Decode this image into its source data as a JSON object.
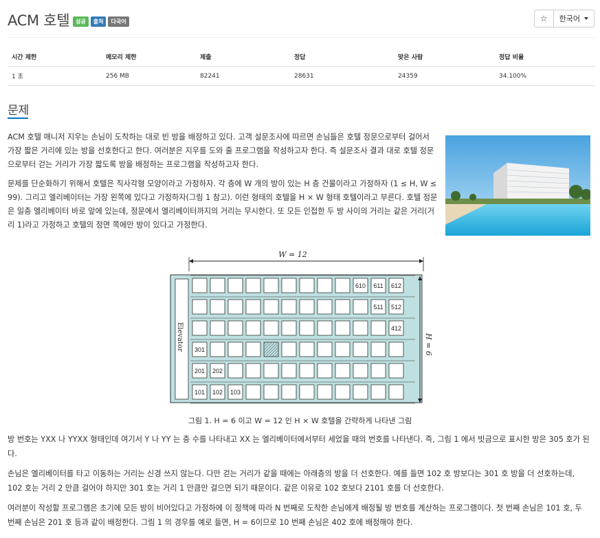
{
  "header": {
    "title": "ACM 호텔",
    "badges": [
      "성공",
      "출처",
      "다국어"
    ],
    "star_label": "☆",
    "language": "한국어"
  },
  "info_table": {
    "headers": [
      "시간 제한",
      "메모리 제한",
      "제출",
      "정답",
      "맞은 사람",
      "정답 비율"
    ],
    "values": [
      "1 초",
      "256 MB",
      "82241",
      "28631",
      "24359",
      "34.100%"
    ]
  },
  "section_title": "문제",
  "problem": {
    "p1": "ACM 호텔 매니저 지우는 손님이 도착하는 대로 빈 방을 배정하고 있다. 고객 설문조사에 따르면 손님들은 호텔 정문으로부터 걸어서 가장 짧은 거리에 있는 방을 선호한다고 한다. 여러분은 지우를 도와 줄 프로그램을 작성하고자 한다. 즉 설문조사 결과 대로 호텔 정문으로부터 걷는 거리가 가장 짧도록 방을 배정하는 프로그램을 작성하고자 한다.",
    "p2": "문제를 단순화하기 위해서 호텔은 직사각형 모양이라고 가정하자. 각 층에 W 개의 방이 있는 H 층 건물이라고 가정하자 (1 ≤ H, W ≤ 99). 그리고 엘리베이터는 가장 왼쪽에 있다고 가정하자(그림 1 참고). 이런 형태의 호텔을 H × W 형태 호텔이라고 부른다. 호텔 정문은 일층 엘리베이터 바로 앞에 있는데, 정문에서 엘리베이터까지의 거리는 무시한다. 또 모든 인접한 두 방 사이의 거리는 같은 거리(거리 1)라고 가정하고 호텔의 정면 쪽에만 방이 있다고 가정한다.",
    "figure": {
      "w_label": "W = 12",
      "h_label": "H = 6",
      "elevator_label": "Elevator",
      "rooms": [
        [
          "",
          "",
          "",
          "",
          "",
          "",
          "",
          "",
          "",
          "610",
          "611",
          "612"
        ],
        [
          "",
          "",
          "",
          "",
          "",
          "",
          "",
          "",
          "",
          "",
          "511",
          "512"
        ],
        [
          "",
          "",
          "",
          "",
          "",
          "",
          "",
          "",
          "",
          "",
          "",
          "412"
        ],
        [
          "301",
          "",
          "",
          "",
          "",
          "",
          "",
          "",
          "",
          "",
          "",
          ""
        ],
        [
          "201",
          "202",
          "",
          "",
          "",
          "",
          "",
          "",
          "",
          "",
          "",
          ""
        ],
        [
          "101",
          "102",
          "103",
          "",
          "",
          "",
          "",
          "",
          "",
          "",
          "",
          ""
        ]
      ],
      "highlighted_room": "305"
    },
    "caption": "그림 1. H = 6 이고 W = 12 인 H × W 호텔을 간략하게 나타낸 그림",
    "p3": "방 번호는 YXX 나 YYXX 형태인데 여기서 Y 나 YY 는 층 수를 나타내고 XX 는 엘리베이터에서부터 세었을 때의 번호를 나타낸다. 즉, 그림 1 에서 빗금으로 표시한 방은 305 호가 된다.",
    "p4": "손님은 엘리베이터를 타고 이동하는 거리는 신경 쓰지 않는다. 다만 걷는 거리가 같을 때에는 아래층의 방을 더 선호한다. 예를 들면 102 호 방보다는 301 호 방을 더 선호하는데, 102 호는 거리 2 만큼 걸어야 하지만 301 호는 거리 1 만큼만 걸으면 되기 때문이다. 같은 이유로 102 호보다 2101 호를 더 선호한다.",
    "p5": "여러분이 작성할 프로그램은 초기에 모든 방이 비어있다고 가정하에 이 정책에 따라 N 번째로 도착한 손님에게 배정될 방 번호를 계산하는 프로그램이다. 첫 번째 손님은 101 호, 두 번째 손님은 201 호 등과 같이 배정한다. 그림 1 의 경우를 예로 들면, H = 6이므로 10 번째 손님은 402 호에 배정해야 한다."
  }
}
